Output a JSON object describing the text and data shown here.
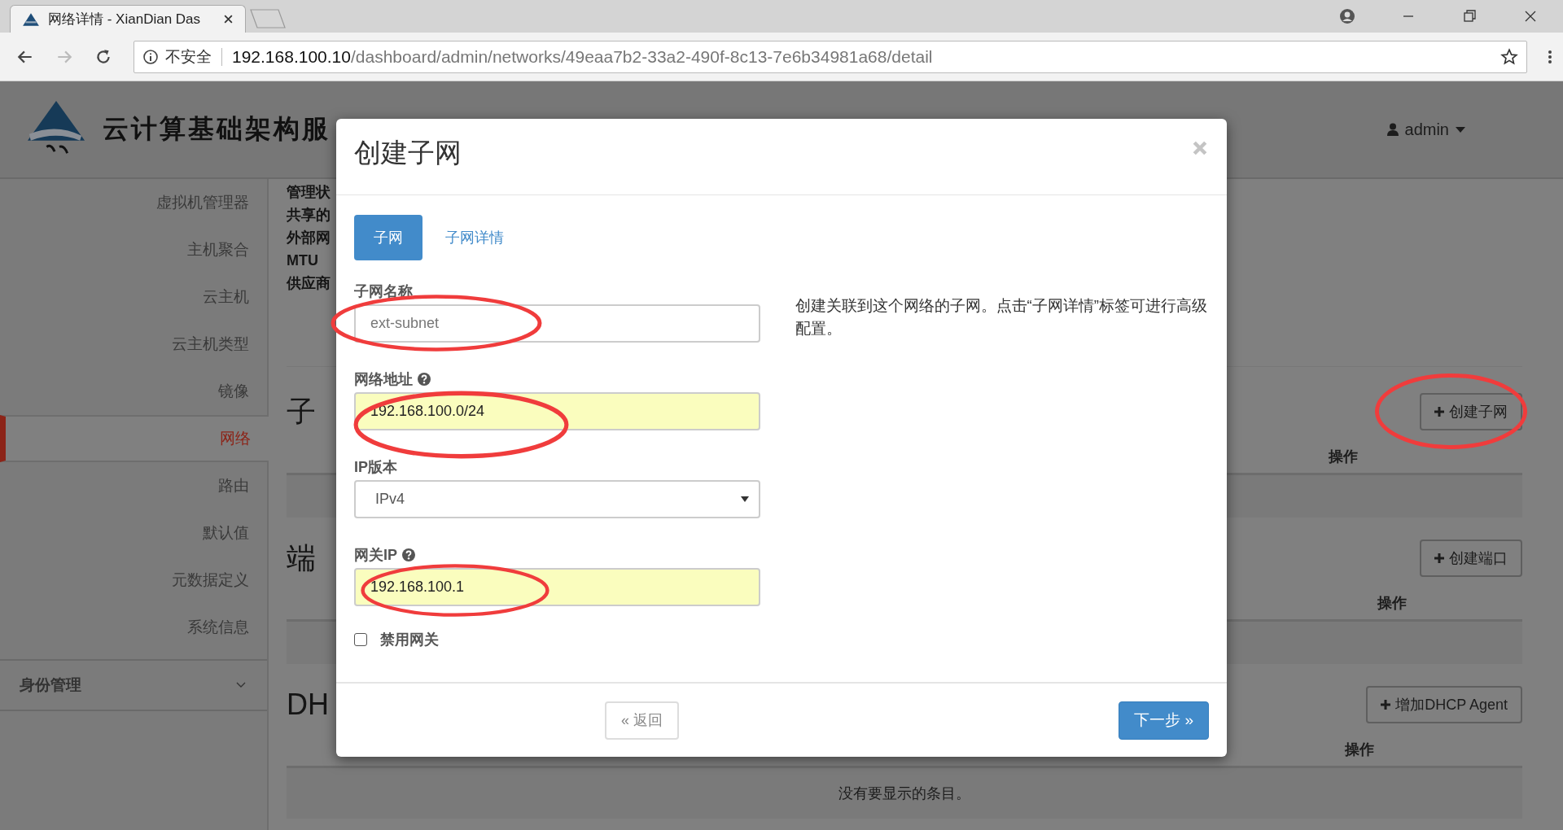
{
  "browser": {
    "tab_title": "网络详情 - XianDian Das",
    "security_label": "不安全",
    "url_host": "192.168.100.10",
    "url_path": "/dashboard/admin/networks/49eaa7b2-33a2-490f-8c13-7e6b34981a68/detail"
  },
  "header": {
    "brand": "云计算基础架构服",
    "user": "admin"
  },
  "sidebar": {
    "items": [
      {
        "label": "虚拟机管理器",
        "selected": false
      },
      {
        "label": "主机聚合",
        "selected": false
      },
      {
        "label": "云主机",
        "selected": false
      },
      {
        "label": "云主机类型",
        "selected": false
      },
      {
        "label": "镜像",
        "selected": false
      },
      {
        "label": "网络",
        "selected": true
      },
      {
        "label": "路由",
        "selected": false
      },
      {
        "label": "默认值",
        "selected": false
      },
      {
        "label": "元数据定义",
        "selected": false
      },
      {
        "label": "系统信息",
        "selected": false
      }
    ],
    "group": {
      "label": "身份管理",
      "expanded": false
    }
  },
  "overview": {
    "labels": [
      "管理状",
      "共享的",
      "外部网",
      "MTU",
      "供应商"
    ]
  },
  "sections": [
    {
      "heading": "子",
      "button": "创建子网",
      "circled": true,
      "column": "操作"
    },
    {
      "heading": "端",
      "button": "创建端口",
      "circled": false,
      "column": "操作"
    },
    {
      "heading": "DH",
      "button": "增加DHCP Agent",
      "circled": false,
      "column": "操作",
      "empty_text": "没有要显示的条目。"
    }
  ],
  "modal": {
    "title": "创建子网",
    "tabs": [
      {
        "label": "子网",
        "selected": true
      },
      {
        "label": "子网详情",
        "selected": false
      }
    ],
    "fields": [
      {
        "kind": "text",
        "label": "子网名称",
        "placeholder": "ext-subnet",
        "circled": true
      },
      {
        "kind": "text",
        "label": "网络地址",
        "help": true,
        "value": "192.168.100.0/24",
        "autofilled": true,
        "circled": true
      },
      {
        "kind": "select",
        "label": "IP版本",
        "value": "IPv4"
      },
      {
        "kind": "text",
        "label": "网关IP",
        "help": true,
        "value": "192.168.100.1",
        "autofilled": true,
        "circled": true
      },
      {
        "kind": "checkbox",
        "label": "禁用网关",
        "checked": false
      }
    ],
    "description": "创建关联到这个网络的子网。点击“子网详情”标签可进行高级配置。",
    "back_button": "« 返回",
    "next_button": "下一步 »"
  }
}
